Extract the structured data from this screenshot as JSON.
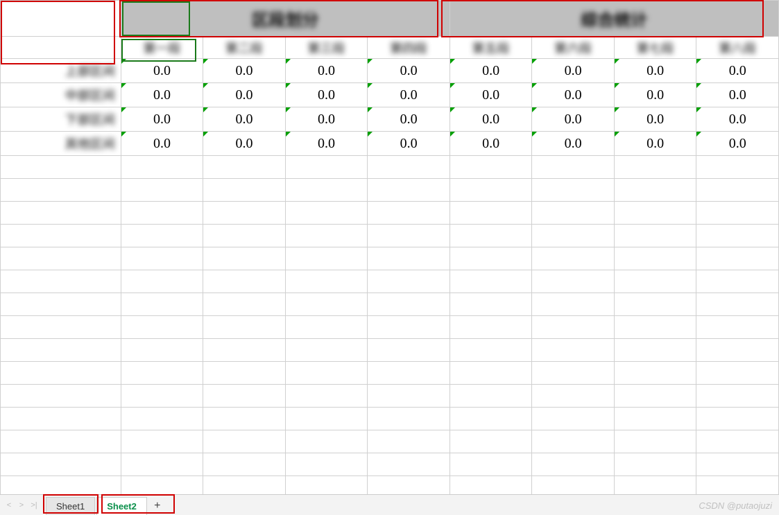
{
  "top_left_cell": "",
  "merged_headers": [
    "区段划分",
    "综合统计"
  ],
  "sub_headers": [
    "第一段",
    "第二段",
    "第三段",
    "第四段",
    "第五段",
    "第六段",
    "第七段",
    "第八段"
  ],
  "rows": [
    {
      "label": "上部区间",
      "values": [
        "0.0",
        "0.0",
        "0.0",
        "0.0",
        "0.0",
        "0.0",
        "0.0",
        "0.0"
      ]
    },
    {
      "label": "中部区间",
      "values": [
        "0.0",
        "0.0",
        "0.0",
        "0.0",
        "0.0",
        "0.0",
        "0.0",
        "0.0"
      ]
    },
    {
      "label": "下部区间",
      "values": [
        "0.0",
        "0.0",
        "0.0",
        "0.0",
        "0.0",
        "0.0",
        "0.0",
        "0.0"
      ]
    },
    {
      "label": "其他区间",
      "values": [
        "0.0",
        "0.0",
        "0.0",
        "0.0",
        "0.0",
        "0.0",
        "0.0",
        "0.0"
      ]
    }
  ],
  "sheet_tabs": [
    {
      "name": "Sheet1",
      "active": false
    },
    {
      "name": "Sheet2",
      "active": true
    }
  ],
  "add_icon": "+",
  "nav": {
    "first": "<",
    "prev": ">",
    "last": ">|"
  },
  "watermark": "CSDN @putaojuzi",
  "annotations": {
    "red_boxes": true,
    "green_boxes": true
  }
}
